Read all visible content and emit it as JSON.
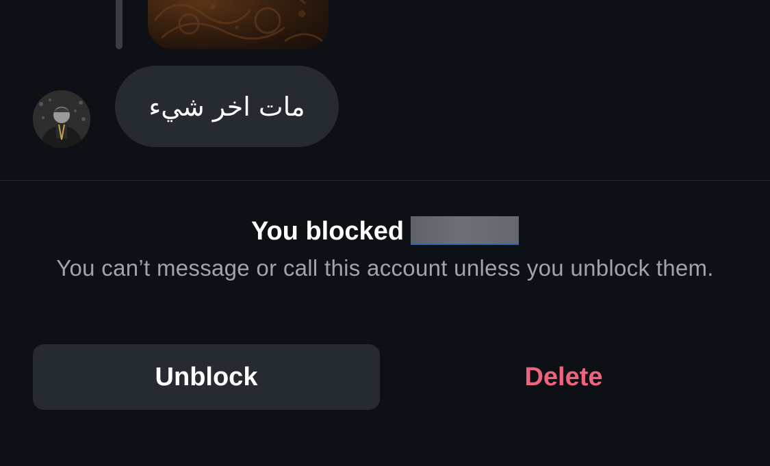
{
  "conversation": {
    "last_message_text": "مات اخر شيء",
    "avatar_icon": "user-avatar-photo",
    "media_icon": "image-thumbnail"
  },
  "blocked_banner": {
    "title_prefix": "You blocked",
    "description": "You can’t message or call this account unless you unblock them."
  },
  "actions": {
    "unblock_label": "Unblock",
    "delete_label": "Delete"
  },
  "colors": {
    "background": "#0d1116",
    "bubble": "#262a31",
    "muted_text": "#a0a5ad",
    "destructive": "#f0637e"
  }
}
